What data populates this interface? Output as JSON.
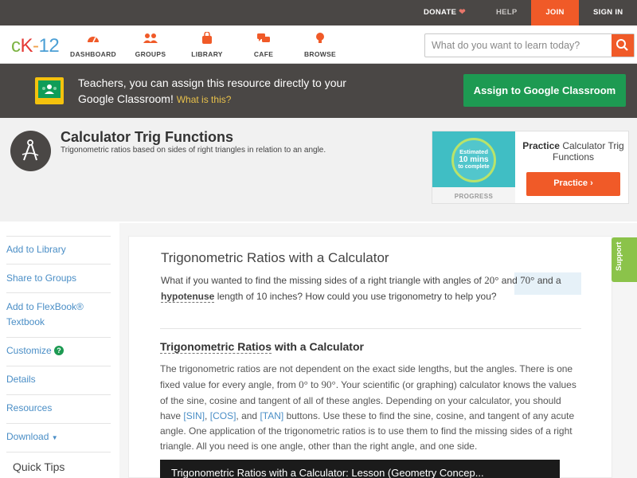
{
  "topbar": {
    "donate": "DONATE",
    "heart": "❤",
    "help": "HELP",
    "join": "JOIN",
    "signin": "SIGN IN"
  },
  "colors": {
    "accent_orange": "#f05a28",
    "green": "#1d9a52",
    "dark_bar": "#4a4745",
    "link_blue": "#4a8ec6",
    "support_green": "#8bc34a"
  },
  "nav": {
    "logo": {
      "c": "c",
      "k": "K",
      "dash": "-",
      "n": "12"
    },
    "items": [
      {
        "label": "DASHBOARD",
        "icon": "speedometer-icon"
      },
      {
        "label": "GROUPS",
        "icon": "people-icon"
      },
      {
        "label": "LIBRARY",
        "icon": "bag-icon"
      },
      {
        "label": "CAFE",
        "icon": "chat-bubbles-icon"
      },
      {
        "label": "BROWSE",
        "icon": "lightbulb-icon"
      }
    ],
    "search_placeholder": "What do you want to learn today?"
  },
  "banner": {
    "text": "Teachers, you can assign this resource directly to your Google Classroom!",
    "what": "What is this?",
    "button": "Assign to Google Classroom"
  },
  "header": {
    "title": "Calculator Trig Functions",
    "subtitle": "Trigonometric ratios based on sides of right triangles in relation to an angle."
  },
  "practice": {
    "est1": "Estimated",
    "est2": "10 mins",
    "est3": "to complete",
    "progress": "PROGRESS",
    "title_bold": "Practice",
    "title_rest": "Calculator Trig Functions",
    "button": "Practice"
  },
  "sidebar": {
    "items": [
      "Add to Library",
      "Share to Groups",
      "Add to FlexBook® Textbook",
      "Customize",
      "Details",
      "Resources",
      "Download"
    ],
    "quick_tips": "Quick Tips"
  },
  "lesson": {
    "title": "Trigonometric Ratios with a Calculator",
    "intro_1": "What if you wanted to find the missing sides of a right triangle with angles of",
    "angle1": "20°",
    "and": "and",
    "angle2": "70°",
    "intro_2": "and a",
    "hyp": "hypotenuse",
    "intro_3": "length of 10 inches? How could you use trigonometry to help you?",
    "section_u": "Trigonometric Ratios",
    "section_rest": " with a Calculator",
    "p1": "The trigonometric ratios are not dependent on the exact side lengths, but the angles. There is one fixed value for every angle, from",
    "from": "0°",
    "to": "to",
    "upto": "90°",
    "p2": ". Your scientific (or graphing) calculator knows the values of the sine, cosine and tangent of all of these angles. Depending on your calculator, you should have",
    "sin": "[SIN]",
    "cos": "[COS]",
    "tan": "[TAN]",
    "comma": ",",
    "and2": ", and",
    "p3": "buttons. Use these to find the sine, cosine, and tangent of any acute angle. One application of the trigonometric ratios is to use them to find the missing sides of a right triangle. All you need is one angle, other than the right angle, and one side.",
    "video_title": "Trigonometric Ratios with a Calculator: Lesson (Geometry Concep..."
  },
  "support": "Support"
}
